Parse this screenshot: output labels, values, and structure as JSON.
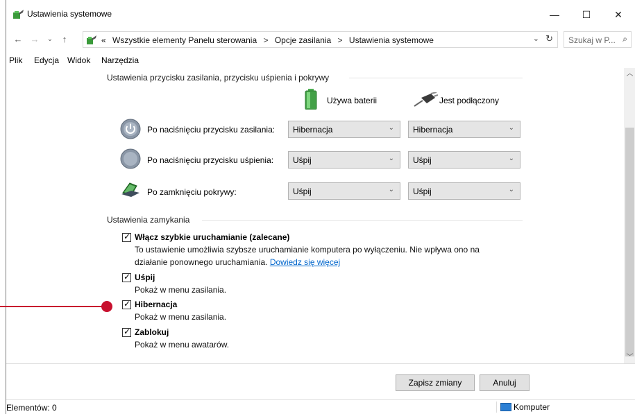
{
  "window": {
    "title": "Ustawienia systemowe",
    "controls": {
      "minimize": "—",
      "maximize": "☐",
      "close": "✕"
    }
  },
  "nav": {
    "back": "←",
    "forward": "→",
    "recent": "⌄",
    "up": "↑",
    "prefix": "«",
    "breadcrumbs": [
      "Wszystkie elementy Panelu sterowania",
      "Opcje zasilania",
      "Ustawienia systemowe"
    ],
    "separator": ">",
    "dropdown": "⌄",
    "refresh": "↻",
    "search_placeholder": "Szukaj w P...",
    "search_icon": "⌕"
  },
  "menu": [
    "Plik",
    "Edycja",
    "Widok",
    "Narzędzia"
  ],
  "power_buttons": {
    "group_title": "Ustawienia przycisku zasilania, przycisku uśpienia i pokrywy",
    "col_battery": "Używa baterii",
    "col_plugged": "Jest podłączony",
    "rows": [
      {
        "icon": "power-button-icon",
        "label": "Po naciśnięciu przycisku zasilania:",
        "battery": "Hibernacja",
        "plugged": "Hibernacja"
      },
      {
        "icon": "sleep-button-icon",
        "label": "Po naciśnięciu przycisku uśpienia:",
        "battery": "Uśpij",
        "plugged": "Uśpij"
      },
      {
        "icon": "laptop-lid-icon",
        "label": "Po zamknięciu pokrywy:",
        "battery": "Uśpij",
        "plugged": "Uśpij"
      }
    ]
  },
  "shutdown": {
    "group_title": "Ustawienia zamykania",
    "fast_startup": {
      "checked": true,
      "title": "Włącz szybkie uruchamianie (zalecane)",
      "desc_line1": "To ustawienie umożliwia szybsze uruchamianie komputera po wyłączeniu. Nie wpływa ono na",
      "desc_line2": "działanie ponownego uruchamiania.",
      "link": "Dowiedz się więcej"
    },
    "sleep": {
      "checked": true,
      "title": "Uśpij",
      "desc": "Pokaż w menu zasilania."
    },
    "hibernate": {
      "checked": true,
      "title": "Hibernacja",
      "desc": "Pokaż w menu zasilania."
    },
    "lock": {
      "checked": true,
      "title": "Zablokuj",
      "desc": "Pokaż w menu awatarów."
    }
  },
  "buttons": {
    "save": "Zapisz zmiany",
    "cancel": "Anuluj"
  },
  "status": {
    "items": "Elementów: 0",
    "location": "Komputer"
  },
  "colors": {
    "accent": "#c8102e",
    "link": "#0066cc",
    "select_bg": "#e5e5e5"
  }
}
